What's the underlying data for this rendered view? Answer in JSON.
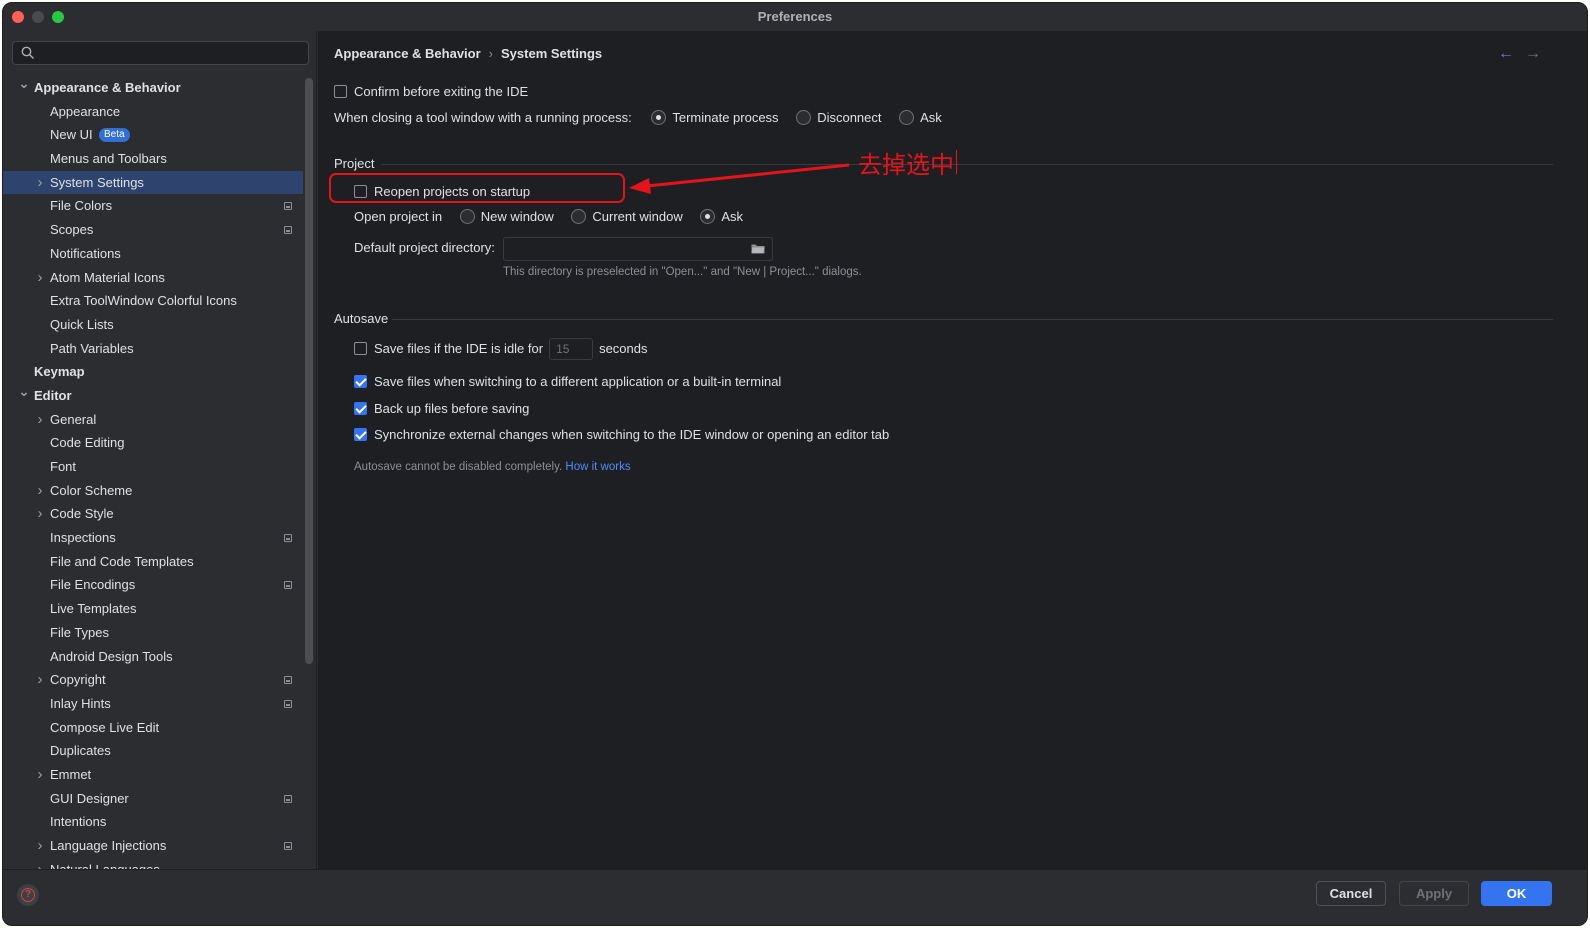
{
  "window": {
    "title": "Preferences"
  },
  "sidebar": {
    "search_placeholder": "",
    "items": [
      {
        "label": "Appearance & Behavior",
        "chevron": "down"
      },
      {
        "label": "Appearance"
      },
      {
        "label": "New UI",
        "badge": "Beta"
      },
      {
        "label": "Menus and Toolbars"
      },
      {
        "label": "System Settings",
        "chevron": "right",
        "selected": true
      },
      {
        "label": "File Colors",
        "project_icon": true
      },
      {
        "label": "Scopes",
        "project_icon": true
      },
      {
        "label": "Notifications"
      },
      {
        "label": "Atom Material Icons",
        "chevron": "right"
      },
      {
        "label": "Extra ToolWindow Colorful Icons"
      },
      {
        "label": "Quick Lists"
      },
      {
        "label": "Path Variables"
      },
      {
        "label": "Keymap"
      },
      {
        "label": "Editor",
        "chevron": "down"
      },
      {
        "label": "General",
        "chevron": "right"
      },
      {
        "label": "Code Editing"
      },
      {
        "label": "Font"
      },
      {
        "label": "Color Scheme",
        "chevron": "right"
      },
      {
        "label": "Code Style",
        "chevron": "right"
      },
      {
        "label": "Inspections",
        "project_icon": true
      },
      {
        "label": "File and Code Templates"
      },
      {
        "label": "File Encodings",
        "project_icon": true
      },
      {
        "label": "Live Templates"
      },
      {
        "label": "File Types"
      },
      {
        "label": "Android Design Tools"
      },
      {
        "label": "Copyright",
        "chevron": "right",
        "project_icon": true
      },
      {
        "label": "Inlay Hints",
        "project_icon": true
      },
      {
        "label": "Compose Live Edit"
      },
      {
        "label": "Duplicates"
      },
      {
        "label": "Emmet",
        "chevron": "right"
      },
      {
        "label": "GUI Designer",
        "project_icon": true
      },
      {
        "label": "Intentions"
      },
      {
        "label": "Language Injections",
        "chevron": "right",
        "project_icon": true
      },
      {
        "label": "Natural Languages",
        "chevron": "right"
      }
    ]
  },
  "main": {
    "breadcrumb": {
      "parent": "Appearance & Behavior",
      "separator": "›",
      "current": "System Settings"
    },
    "nav": {
      "back": "←",
      "forward": "→"
    },
    "confirm_exit": {
      "label": "Confirm before exiting the IDE",
      "checked": false
    },
    "closing_tool_window": {
      "label": "When closing a tool window with a running process:",
      "options": [
        {
          "label": "Terminate process",
          "selected": true
        },
        {
          "label": "Disconnect",
          "selected": false
        },
        {
          "label": "Ask",
          "selected": false
        }
      ]
    },
    "project": {
      "title": "Project",
      "reopen": {
        "label": "Reopen projects on startup",
        "checked": false
      },
      "open_in": {
        "label": "Open project in",
        "options": [
          {
            "label": "New window",
            "selected": false
          },
          {
            "label": "Current window",
            "selected": false
          },
          {
            "label": "Ask",
            "selected": true
          }
        ]
      },
      "default_dir": {
        "label": "Default project directory:",
        "value": "",
        "hint": "This directory is preselected in \"Open...\" and \"New | Project...\" dialogs."
      }
    },
    "autosave": {
      "title": "Autosave",
      "idle": {
        "label": "Save files if the IDE is idle for",
        "value": "15",
        "unit": "seconds",
        "checked": false
      },
      "switching": {
        "label": "Save files when switching to a different application or a built-in terminal",
        "checked": true
      },
      "backup": {
        "label": "Back up files before saving",
        "checked": true
      },
      "sync": {
        "label": "Synchronize external changes when switching to the IDE window or opening an editor tab",
        "checked": true
      },
      "note": "Autosave cannot be disabled completely.",
      "note_link": "How it works"
    }
  },
  "annotation": {
    "text": "去掉选中",
    "color": "#e5141b"
  },
  "footer": {
    "cancel": "Cancel",
    "apply": "Apply",
    "ok": "OK"
  },
  "colors": {
    "accent": "#3574f0",
    "selection": "#2e436e",
    "background": "#1e1f22",
    "panel": "#2b2d30"
  }
}
